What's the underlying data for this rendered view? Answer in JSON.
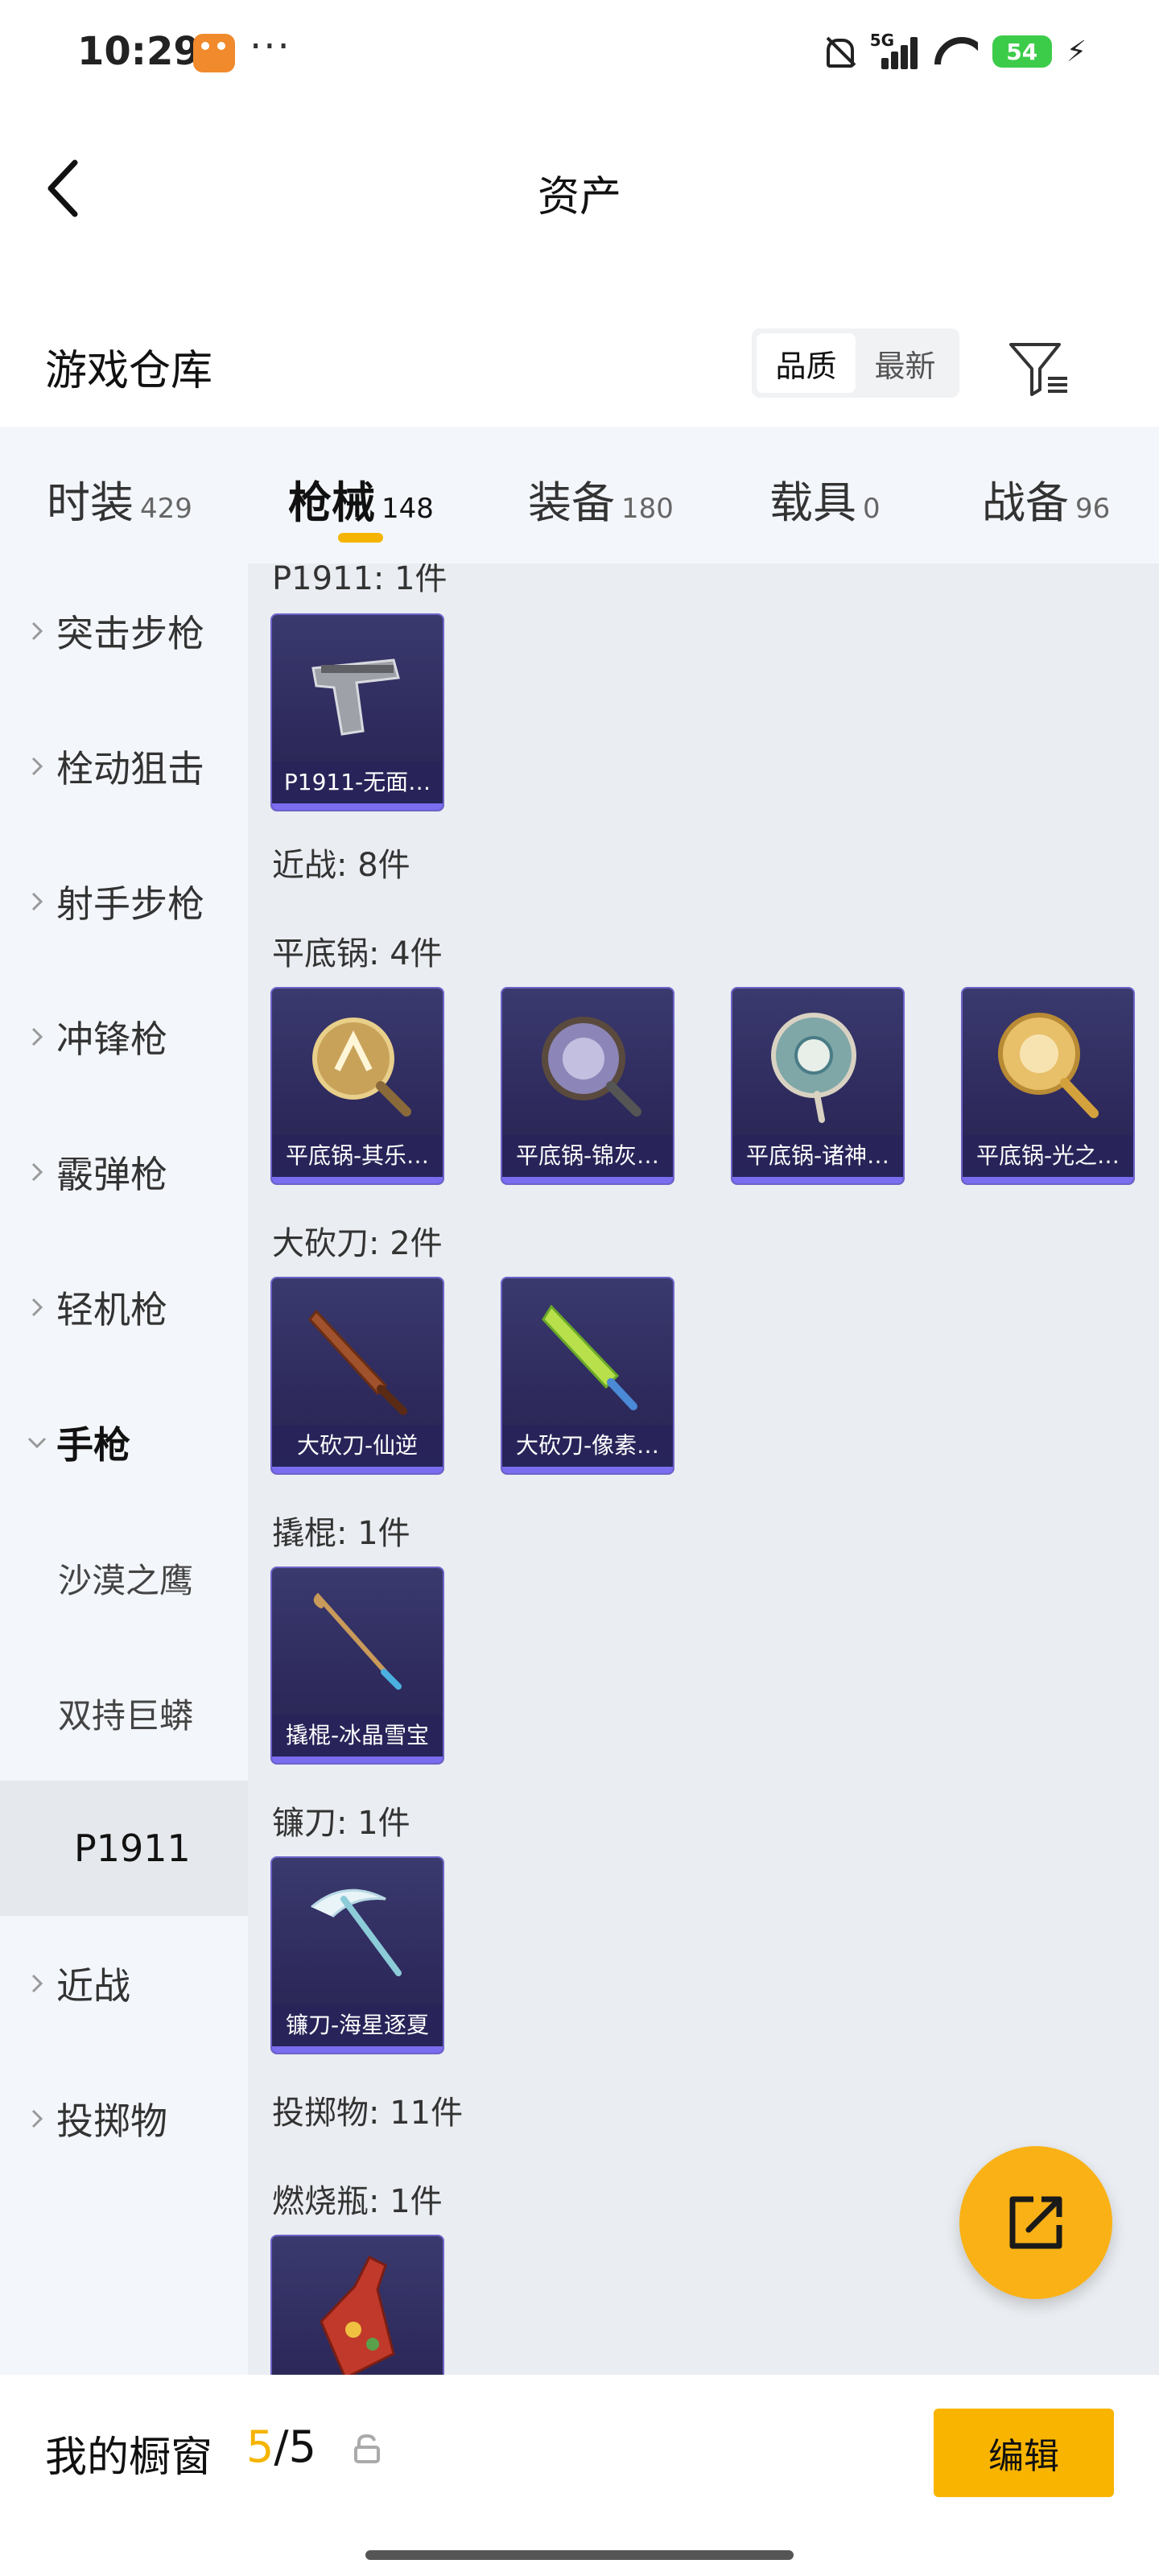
{
  "status_bar": {
    "time": "10:29",
    "dots": "···",
    "signal_label": "5G",
    "battery": "54"
  },
  "header": {
    "title": "资产"
  },
  "warehouse": {
    "title": "游戏仓库",
    "sort_options": [
      "品质",
      "最新"
    ],
    "active_sort": "品质"
  },
  "tabs": [
    {
      "label": "时装",
      "count": "429"
    },
    {
      "label": "枪械",
      "count": "148"
    },
    {
      "label": "装备",
      "count": "180"
    },
    {
      "label": "载具",
      "count": "0"
    },
    {
      "label": "战备",
      "count": "96"
    }
  ],
  "active_tab": "枪械",
  "sidebar": {
    "items": [
      {
        "label": "突击步枪"
      },
      {
        "label": "栓动狙击"
      },
      {
        "label": "射手步枪"
      },
      {
        "label": "冲锋枪"
      },
      {
        "label": "霰弹枪"
      },
      {
        "label": "轻机枪"
      },
      {
        "label": "手枪"
      },
      {
        "label": "沙漠之鹰"
      },
      {
        "label": "双持巨蟒"
      },
      {
        "label": "P1911"
      },
      {
        "label": "近战"
      },
      {
        "label": "投掷物"
      }
    ]
  },
  "content": {
    "sections": [
      {
        "title": "P1911: 1件"
      },
      {
        "title": "近战: 8件"
      },
      {
        "title": "平底锅: 4件"
      },
      {
        "title": "大砍刀: 2件"
      },
      {
        "title": "撬棍: 1件"
      },
      {
        "title": "镰刀: 1件"
      },
      {
        "title": "投掷物: 11件"
      },
      {
        "title": "燃烧瓶: 1件"
      }
    ],
    "cards": [
      {
        "name": "P1911-无面…",
        "icon": "pistol-icon"
      },
      {
        "name": "平底锅-其乐…",
        "icon": "pan-icon"
      },
      {
        "name": "平底锅-锦灰…",
        "icon": "pan-icon"
      },
      {
        "name": "平底锅-诸神…",
        "icon": "pan-icon"
      },
      {
        "name": "平底锅-光之…",
        "icon": "pan-icon"
      },
      {
        "name": "大砍刀-仙逆",
        "icon": "machete-icon"
      },
      {
        "name": "大砍刀-像素…",
        "icon": "machete-icon"
      },
      {
        "name": "撬棍-冰晶雪宝",
        "icon": "crowbar-icon"
      },
      {
        "name": "镰刀-海星逐夏",
        "icon": "sickle-icon"
      },
      {
        "name": "",
        "icon": "molotov-icon"
      }
    ]
  },
  "bottom_bar": {
    "label": "我的橱窗",
    "current": "5",
    "separator": "/",
    "total": "5",
    "edit_label": "编辑"
  },
  "colors": {
    "accent": "#f9b400",
    "card_bg": "#2f2b5e",
    "card_border": "#6d63c9"
  }
}
